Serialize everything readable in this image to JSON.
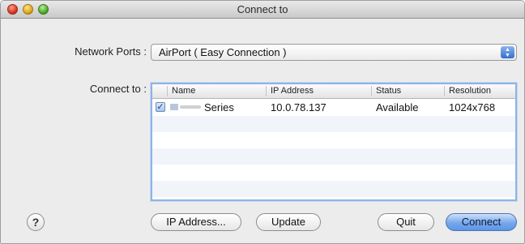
{
  "window": {
    "title": "Connect to"
  },
  "network_ports": {
    "label": "Network Ports :",
    "selected": "AirPort ( Easy Connection )"
  },
  "connect_to": {
    "label": "Connect to :",
    "columns": [
      "Name",
      "IP Address",
      "Status",
      "Resolution"
    ],
    "rows": [
      {
        "checked": true,
        "name": "Series",
        "ip": "10.0.78.137",
        "status": "Available",
        "resolution": "1024x768"
      }
    ]
  },
  "buttons": {
    "help": "?",
    "ip_address": "IP Address...",
    "update": "Update",
    "quit": "Quit",
    "connect": "Connect"
  },
  "colors": {
    "accent": "#5b95e6",
    "selection_border": "#8fb3e4"
  }
}
